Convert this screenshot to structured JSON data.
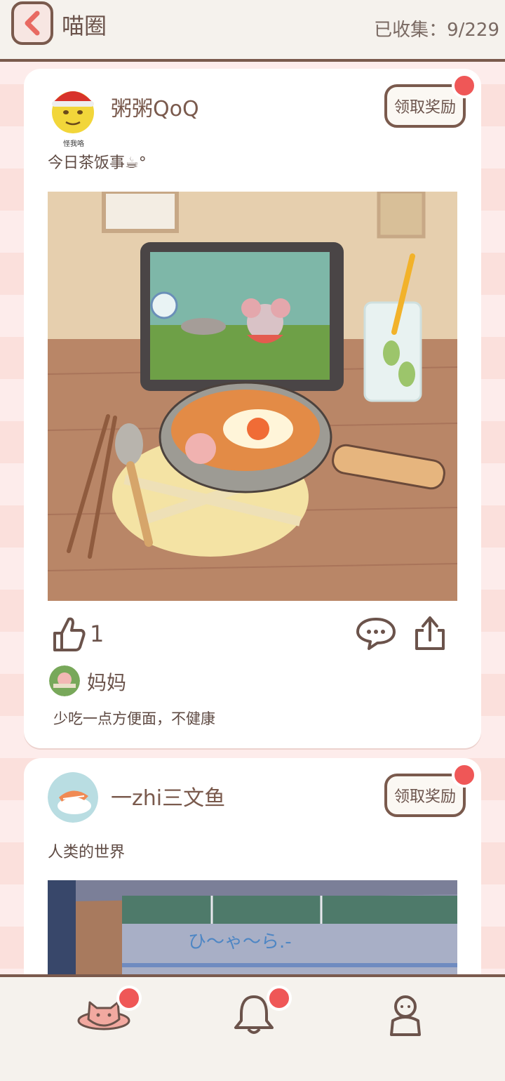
{
  "header": {
    "title": "喵圈",
    "collected_text": "已收集：9/229"
  },
  "posts": [
    {
      "username": "粥粥QoQ",
      "avatar_caption": "怪我咯",
      "text": "今日茶饭事☕︎°",
      "reward_label": "领取奖励",
      "likes": "1",
      "comment": {
        "author": "妈妈",
        "text": "少吃一点方便面，不健康"
      }
    },
    {
      "username": "一zhi三文鱼",
      "text": "人类的世界",
      "reward_label": "领取奖励",
      "image_sign_text": "ひ〜ゃ〜ら.-"
    }
  ],
  "bottom_nav": [
    {
      "icon": "planet-cat-icon",
      "badge": true
    },
    {
      "icon": "bell-icon",
      "badge": true
    },
    {
      "icon": "profile-icon",
      "badge": false
    }
  ],
  "colors": {
    "accent_red": "#ef5757",
    "border_brown": "#7a5a4d",
    "bar_background": "#f5f2ed",
    "stripe_pink": "#fbe0dc"
  }
}
